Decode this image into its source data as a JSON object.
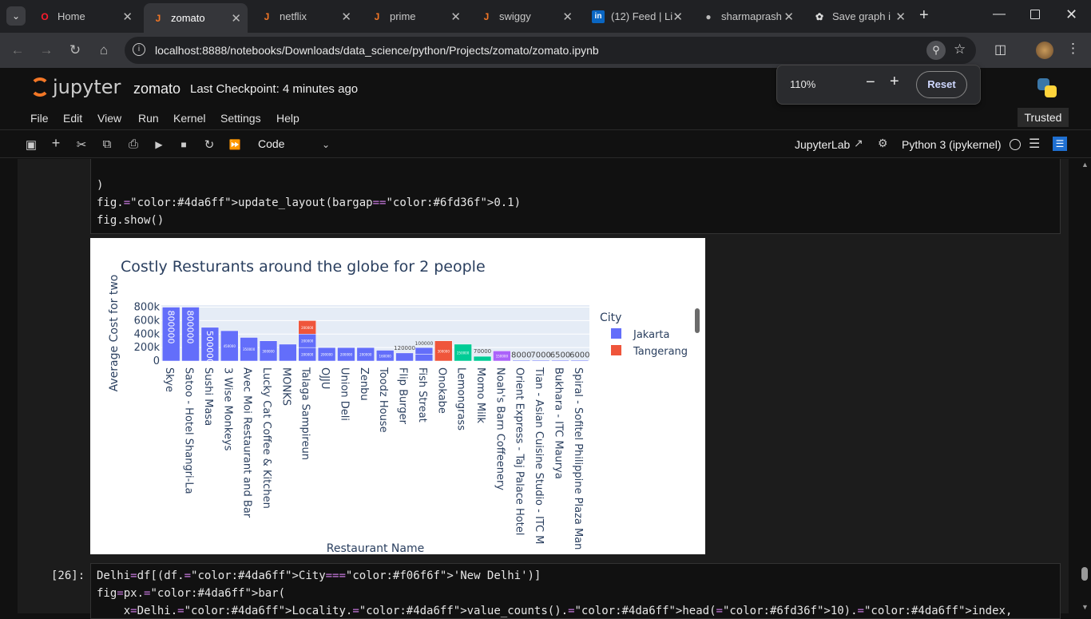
{
  "browser": {
    "tabs": [
      {
        "label": "Home",
        "icon": "opera-icon"
      },
      {
        "label": "zomato",
        "icon": "jupyter-file-icon"
      },
      {
        "label": "netflix",
        "icon": "jupyter-file-icon"
      },
      {
        "label": "prime",
        "icon": "jupyter-file-icon"
      },
      {
        "label": "swiggy",
        "icon": "jupyter-file-icon"
      },
      {
        "label": "(12) Feed | Li",
        "icon": "linkedin-icon"
      },
      {
        "label": "sharmaprash",
        "icon": "github-icon"
      },
      {
        "label": "Save graph i",
        "icon": "chatgpt-icon"
      }
    ],
    "url": "localhost:8888/notebooks/Downloads/data_science/python/Projects/zomato/zomato.ipynb",
    "zoom": {
      "value": "110%",
      "reset": "Reset",
      "minus": "−",
      "plus": "+"
    }
  },
  "jupyter": {
    "logo": "jupyter",
    "notebook_name": "zomato",
    "checkpoint": "Last Checkpoint: 4 minutes ago",
    "trusted": "Trusted",
    "menu": [
      "File",
      "Edit",
      "View",
      "Run",
      "Kernel",
      "Settings",
      "Help"
    ],
    "cell_type": "Code",
    "jupyterlab": "JupyterLab",
    "kernel": "Python 3 (ipykernel)"
  },
  "cells": {
    "prev": {
      "lines": [
        ")",
        "fig.update_layout(bargap=0.1)",
        "fig.show()"
      ]
    },
    "next": {
      "prompt": "[26]:",
      "lines": [
        "Delhi=df[(df.City=='New Delhi')]",
        "fig=px.bar(",
        "    x=Delhi.Locality.value_counts().head(10).index,"
      ]
    }
  },
  "colors": {
    "jakarta": "#636efa",
    "tangerang": "#ef553b",
    "green": "#00cc96",
    "purple": "#ab63fa",
    "plot_bg": "#e5ecf6"
  },
  "chart_data": {
    "type": "bar",
    "title": "Costly Resturants around the globe for 2 people",
    "xlabel": "Restaurant Name",
    "ylabel": "Average Cost for two",
    "legend_title": "City",
    "legend": [
      "Jakarta",
      "Tangerang"
    ],
    "yticks": [
      "800k",
      "600k",
      "400k",
      "200k",
      "0"
    ],
    "ylim": [
      0,
      830000
    ],
    "categories": [
      "Skye",
      "Satoo - Hotel Shangri-La",
      "Sushi Masa",
      "3 Wise Monkeys",
      "Avec Moi Restaurant and Bar",
      "Lucky Cat Coffee & Kitchen",
      "MONKS",
      "Talaga Sampireun",
      "OJJU",
      "Union Deli",
      "Zenbu",
      "Toodz House",
      "Flip Burger",
      "Fish Streat",
      "Onokabe",
      "Lemongrass",
      "Momo Milk",
      "Noah's Barn Coffeenery",
      "Orient Express - Taj Palace Hotel",
      "Tian - Asian Cuisine Studio - ITC M",
      "Bukhara - ITC Maurya",
      "Spiral - Sofitel Philippine Plaza Man"
    ],
    "segments": [
      [
        {
          "v": 800000,
          "c": "jakarta",
          "label": "800000"
        }
      ],
      [
        {
          "v": 800000,
          "c": "jakarta",
          "label": "800000"
        }
      ],
      [
        {
          "v": 500000,
          "c": "jakarta",
          "label": "500000"
        }
      ],
      [
        {
          "v": 450000,
          "c": "jakarta",
          "label": "450000"
        }
      ],
      [
        {
          "v": 350000,
          "c": "jakarta",
          "label": "350000"
        }
      ],
      [
        {
          "v": 300000,
          "c": "jakarta",
          "label": "300000"
        }
      ],
      [
        {
          "v": 250000,
          "c": "jakarta",
          "label": ""
        }
      ],
      [
        {
          "v": 200000,
          "c": "jakarta",
          "label": "200000"
        },
        {
          "v": 200000,
          "c": "jakarta",
          "label": "200000"
        },
        {
          "v": 200000,
          "c": "tangerang",
          "label": "200000"
        }
      ],
      [
        {
          "v": 200000,
          "c": "jakarta",
          "label": "200000"
        }
      ],
      [
        {
          "v": 200000,
          "c": "jakarta",
          "label": "200000"
        }
      ],
      [
        {
          "v": 200000,
          "c": "jakarta",
          "label": "200000"
        }
      ],
      [
        {
          "v": 160000,
          "c": "jakarta",
          "label": "160000"
        }
      ],
      [
        {
          "v": 120000,
          "c": "jakarta",
          "label": "120000"
        }
      ],
      [
        {
          "v": 100000,
          "c": "jakarta",
          "label": ""
        },
        {
          "v": 100000,
          "c": "jakarta",
          "label": "100000"
        }
      ],
      [
        {
          "v": 300000,
          "c": "tangerang",
          "label": "300000"
        }
      ],
      [
        {
          "v": 250000,
          "c": "green",
          "label": "250000"
        }
      ],
      [
        {
          "v": 70000,
          "c": "green",
          "label": "70000"
        }
      ],
      [
        {
          "v": 150000,
          "c": "purple",
          "label": "150000"
        }
      ],
      [
        {
          "v": 8000,
          "c": "jakarta",
          "label": "8000"
        }
      ],
      [
        {
          "v": 7000,
          "c": "jakarta",
          "label": "7000"
        }
      ],
      [
        {
          "v": 6500,
          "c": "jakarta",
          "label": "6500"
        }
      ],
      [
        {
          "v": 6000,
          "c": "jakarta",
          "label": "6000"
        }
      ]
    ]
  }
}
